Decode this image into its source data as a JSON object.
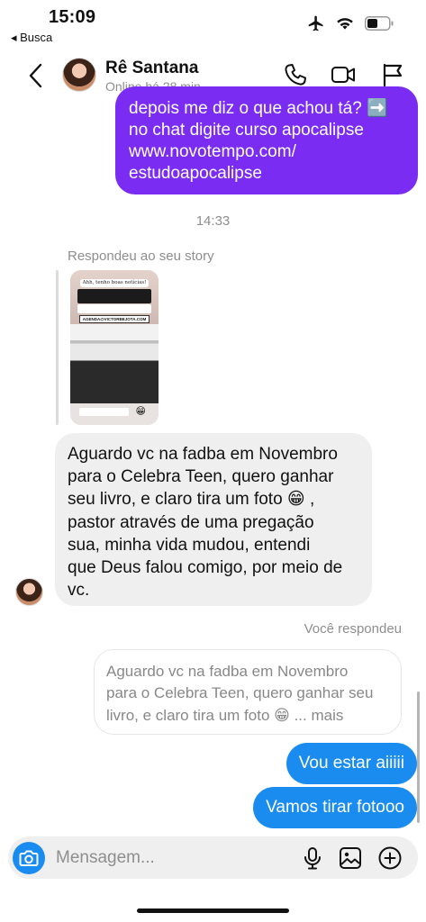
{
  "status_bar": {
    "time": "15:09",
    "back_app": "◂ Busca",
    "icons": [
      "airplane-icon",
      "wifi-icon",
      "battery-icon"
    ]
  },
  "header": {
    "name": "Rê Santana",
    "status": "Online há 28 min",
    "actions": [
      "phone-icon",
      "video-icon",
      "flag-icon"
    ]
  },
  "messages": {
    "outgoing_promo": "depois me diz o que achou tá? ➡️\nno chat digite curso apocalipse\nwww.novotempo.com/\nestudoapocalipse",
    "timestamp": "14:33",
    "story_reply_label": "Respondeu ao seu story",
    "story": {
      "card_title": "Ahh, tenho boas notícias!",
      "card_link": "AGENDA@VICTORBEJOTA.COM",
      "emoji": "😁"
    },
    "incoming_text": "Aguardo vc na fadba em Novembro\npara o Celebra Teen, quero ganhar\nseu livro, e claro tira um foto 😁 ,\npastor através de uma pregação\nsua, minha vida mudou, entendi\nque Deus falou comigo, por meio de\nvc.",
    "you_replied_label": "Você respondeu",
    "quoted_text": "Aguardo vc na fadba em Novembro\npara o Celebra Teen, quero ganhar seu\nlivro, e claro tira um foto 😁 ... mais",
    "reply_1": "Vou estar aiiiii",
    "reply_2": "Vamos tirar fotooo"
  },
  "composer": {
    "placeholder": "Mensagem...",
    "icons": [
      "camera-icon",
      "microphone-icon",
      "gallery-icon",
      "add-icon"
    ]
  },
  "colors": {
    "purple_bubble": "#7a2cf2",
    "blue_bubble": "#1a8cf0",
    "incoming_bubble": "#efefef",
    "muted_text": "#8e8e8e"
  }
}
